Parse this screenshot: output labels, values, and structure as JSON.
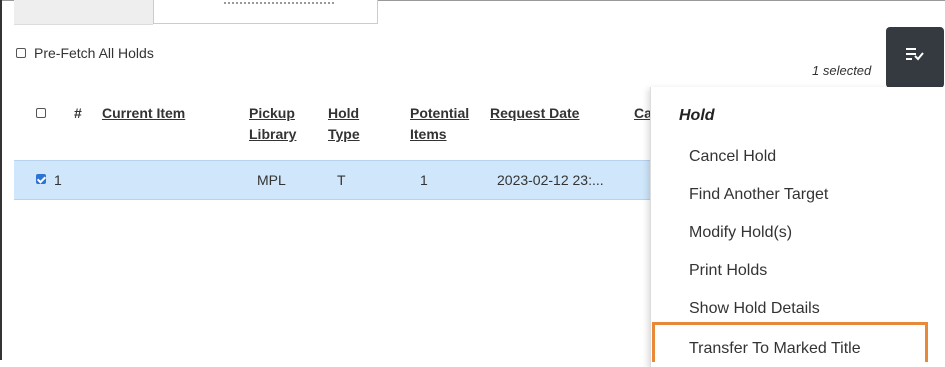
{
  "toolbar": {
    "prefetch_label": "Pre-Fetch All Holds",
    "selected_text": "1 selected",
    "actions_icon": "list-check-icon"
  },
  "table": {
    "columns": [
      "#",
      "Current Item",
      "Pickup Library",
      "Hold Type",
      "Potential Items",
      "Request Date",
      "Ca"
    ],
    "column_lines": {
      "pickup": [
        "Pickup",
        "Library"
      ],
      "holdtype": [
        "Hold",
        "Type"
      ],
      "potential": [
        "Potential",
        "Items"
      ]
    },
    "rows": [
      {
        "num": "1",
        "current_item": "",
        "pickup": "MPL",
        "hold_type": "T",
        "potential": "1",
        "request_date": "2023-02-12 23:...",
        "selected": true
      }
    ]
  },
  "menu": {
    "header": "Hold",
    "items": [
      "Cancel Hold",
      "Find Another Target",
      "Modify Hold(s)",
      "Print Holds",
      "Show Hold Details",
      "Transfer To Marked Title"
    ]
  },
  "colors": {
    "selected_row": "#cfe6fb",
    "checkbox_checked": "#2d74d6",
    "actions_button": "#343a40",
    "highlight": "#e8893a"
  }
}
